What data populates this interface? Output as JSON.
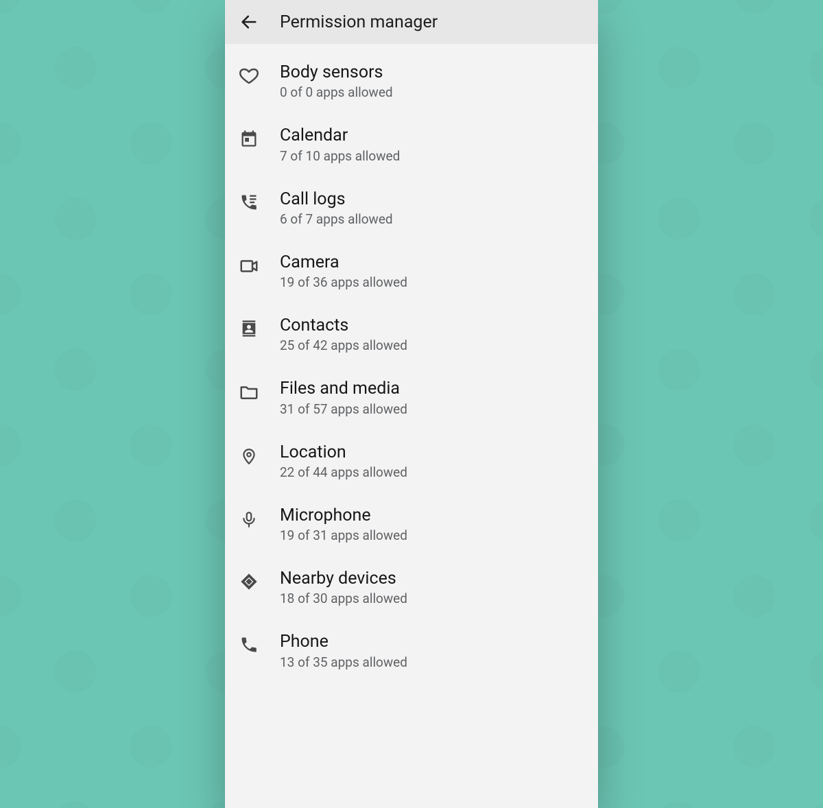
{
  "appbar": {
    "title": "Permission manager"
  },
  "items": [
    {
      "icon": "heart",
      "title": "Body sensors",
      "subtitle": "0 of 0 apps allowed"
    },
    {
      "icon": "calendar",
      "title": "Calendar",
      "subtitle": "7 of 10 apps allowed"
    },
    {
      "icon": "calllogs",
      "title": "Call logs",
      "subtitle": "6 of 7 apps allowed"
    },
    {
      "icon": "camera",
      "title": "Camera",
      "subtitle": "19 of 36 apps allowed"
    },
    {
      "icon": "contacts",
      "title": "Contacts",
      "subtitle": "25 of 42 apps allowed"
    },
    {
      "icon": "folder",
      "title": "Files and media",
      "subtitle": "31 of 57 apps allowed"
    },
    {
      "icon": "location",
      "title": "Location",
      "subtitle": "22 of 44 apps allowed"
    },
    {
      "icon": "mic",
      "title": "Microphone",
      "subtitle": "19 of 31 apps allowed"
    },
    {
      "icon": "nearby",
      "title": "Nearby devices",
      "subtitle": "18 of 30 apps allowed"
    },
    {
      "icon": "phone",
      "title": "Phone",
      "subtitle": "13 of 35 apps allowed"
    }
  ]
}
